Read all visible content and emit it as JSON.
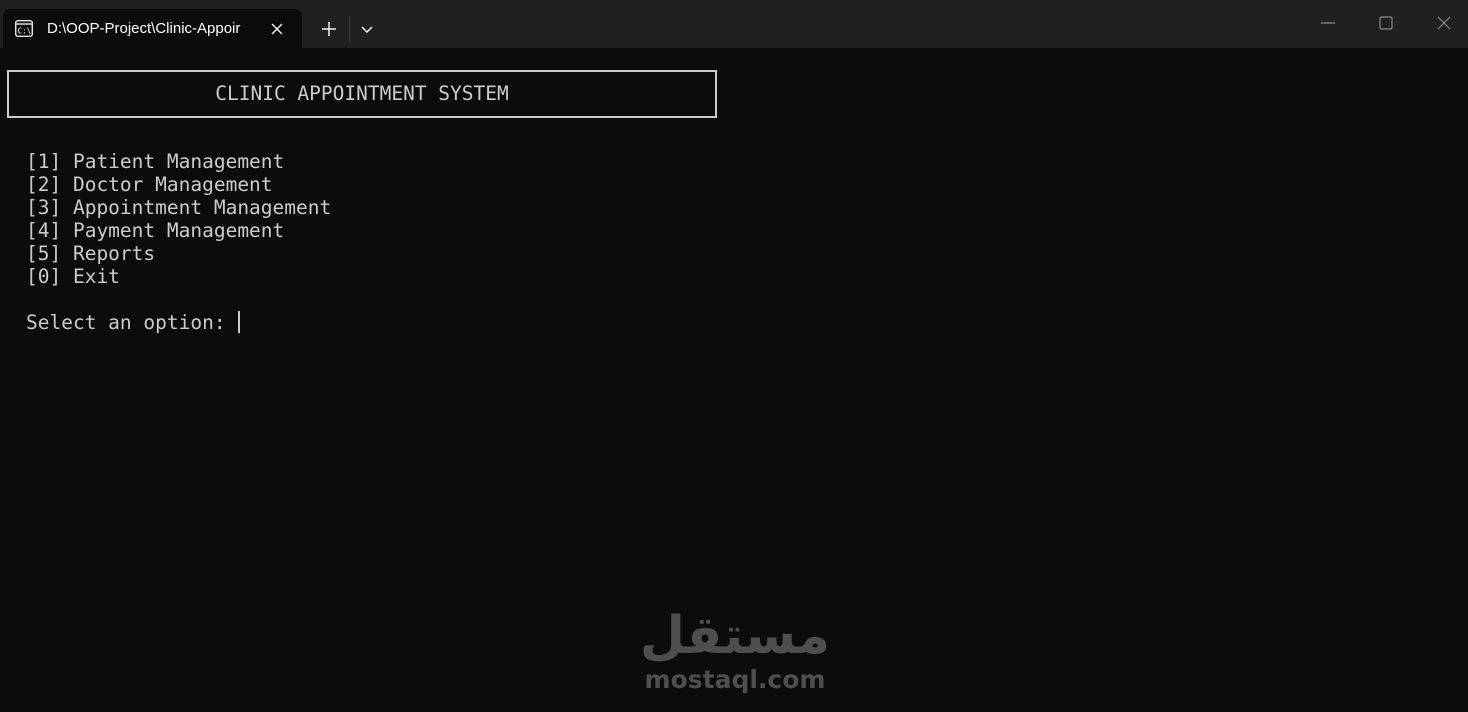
{
  "titlebar": {
    "tab_title": "D:\\OOP-Project\\Clinic-Appoir",
    "tab_icon": "terminal-icon",
    "close_tab_icon": "close-icon",
    "new_tab_icon": "plus-icon",
    "dropdown_icon": "chevron-down-icon",
    "window_controls": [
      "minimize-icon",
      "maximize-icon",
      "close-icon"
    ]
  },
  "console": {
    "header": "CLINIC APPOINTMENT SYSTEM",
    "menu": [
      "[1] Patient Management",
      "[2] Doctor Management",
      "[3] Appointment Management",
      "[4] Payment Management",
      "[5] Reports",
      "[0] Exit"
    ],
    "prompt": "Select an option:",
    "input_value": ""
  },
  "watermark": {
    "arabic": "مستقل",
    "latin": "mostaql.com"
  },
  "colors": {
    "background": "#0c0c0c",
    "titlebar": "#202020",
    "text": "#cccccc",
    "watermark": "#5a5a5a"
  }
}
